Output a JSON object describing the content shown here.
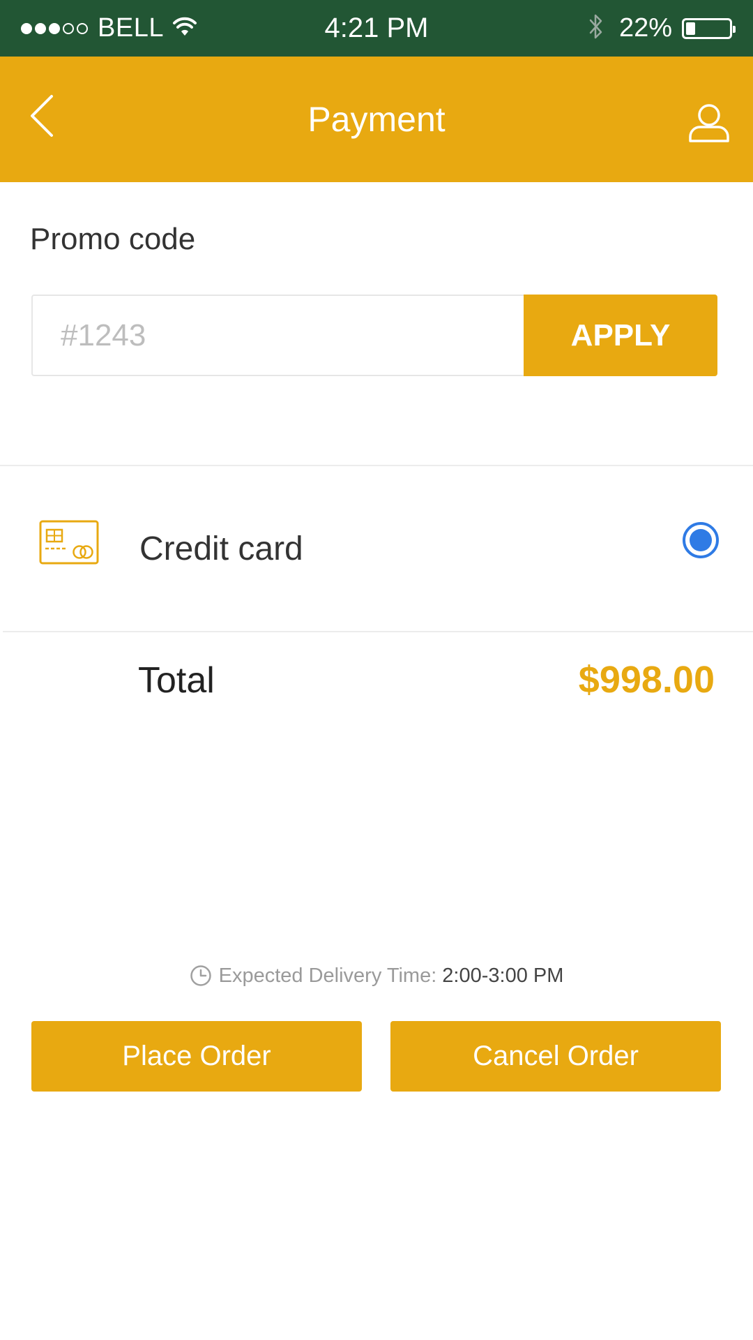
{
  "status_bar": {
    "carrier": "BELL",
    "time": "4:21 PM",
    "battery": "22%",
    "battery_level": 0.22,
    "signal_bars": 3,
    "signal_total": 5
  },
  "header": {
    "title": "Payment",
    "back_icon": "chevron-left-icon",
    "profile_icon": "user-icon"
  },
  "promo": {
    "label": "Promo code",
    "placeholder": "#1243",
    "value": "",
    "apply_label": "APPLY"
  },
  "payment": {
    "method_label": "Credit card",
    "icon": "credit-card-icon",
    "selected": true
  },
  "total": {
    "label": "Total",
    "value": "$998.00"
  },
  "delivery": {
    "label": "Expected Delivery Time:",
    "value": "2:00-3:00 PM"
  },
  "actions": {
    "place_order": "Place Order",
    "cancel_order": "Cancel Order"
  },
  "colors": {
    "status_bar_bg": "#225634",
    "accent": "#E8A911",
    "radio_blue": "#2F7BE5"
  }
}
